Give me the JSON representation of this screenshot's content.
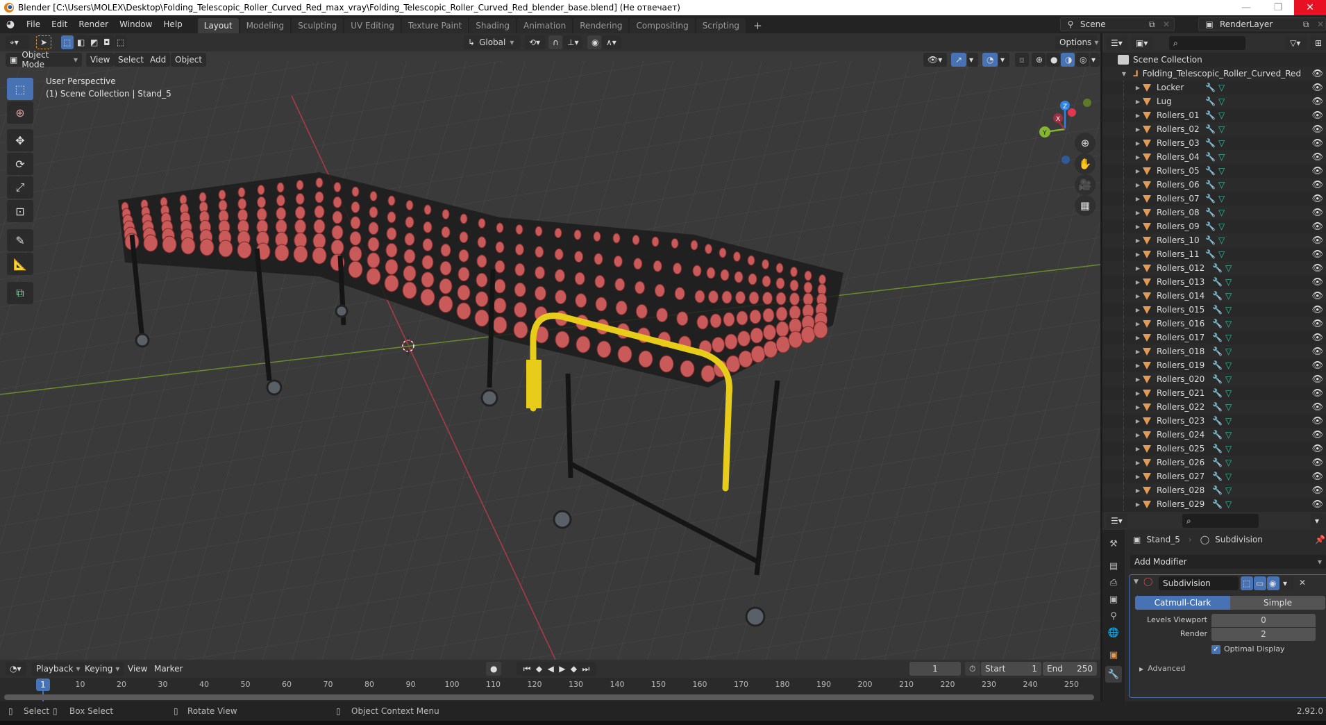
{
  "window": {
    "title": "Blender [C:\\Users\\MOLEX\\Desktop\\Folding_Telescopic_Roller_Curved_Red_max_vray\\Folding_Telescopic_Roller_Curved_Red_blender_base.blend] (Не отвечает)",
    "minimize": "—",
    "maximize": "❐",
    "close": "✕"
  },
  "menu": [
    "File",
    "Edit",
    "Render",
    "Window",
    "Help"
  ],
  "workspaces": [
    {
      "label": "Layout",
      "active": true
    },
    {
      "label": "Modeling"
    },
    {
      "label": "Sculpting"
    },
    {
      "label": "UV Editing"
    },
    {
      "label": "Texture Paint"
    },
    {
      "label": "Shading"
    },
    {
      "label": "Animation"
    },
    {
      "label": "Rendering"
    },
    {
      "label": "Compositing"
    },
    {
      "label": "Scripting"
    }
  ],
  "add_workspace": "+",
  "scene": {
    "label": "Scene",
    "view_layer": "RenderLayer"
  },
  "viewport": {
    "transform_orientation": "Global",
    "options_label": "Options",
    "mode": "Object Mode",
    "menus": [
      "View",
      "Select",
      "Add",
      "Object"
    ],
    "overlay_line1": "User Perspective",
    "overlay_line2": "(1) Scene Collection | Stand_5",
    "gizmo_axes": {
      "x": "X",
      "y": "Y",
      "z": "Z"
    },
    "colors": {
      "x_axis": "#e2374e",
      "y_axis": "#84b52e",
      "z_axis": "#2f84e3",
      "roller": "#c95a5a",
      "guard": "#f0d020"
    }
  },
  "outliner": {
    "root": "Scene Collection",
    "collection": "Folding_Telescopic_Roller_Curved_Red",
    "objects": [
      "Locker",
      "Lug",
      "Rollers_01",
      "Rollers_02",
      "Rollers_03",
      "Rollers_04",
      "Rollers_05",
      "Rollers_06",
      "Rollers_07",
      "Rollers_08",
      "Rollers_09",
      "Rollers_10",
      "Rollers_11",
      "Rollers_012",
      "Rollers_013",
      "Rollers_014",
      "Rollers_015",
      "Rollers_016",
      "Rollers_017",
      "Rollers_018",
      "Rollers_019",
      "Rollers_020",
      "Rollers_021",
      "Rollers_022",
      "Rollers_023",
      "Rollers_024",
      "Rollers_025",
      "Rollers_026",
      "Rollers_027",
      "Rollers_028",
      "Rollers_029"
    ]
  },
  "properties": {
    "object": "Stand_5",
    "modifier_breadcrumb": "Subdivision",
    "add_modifier": "Add Modifier",
    "modifier": {
      "name": "Subdivision",
      "mode_options": [
        "Catmull-Clark",
        "Simple"
      ],
      "active_mode": "Catmull-Clark",
      "levels_viewport_label": "Levels Viewport",
      "levels_viewport": "0",
      "render_label": "Render",
      "render": "2",
      "optimal_display_label": "Optimal Display",
      "optimal_display": true,
      "advanced_label": "Advanced"
    }
  },
  "timeline": {
    "menus": [
      "Playback",
      "Keying",
      "View",
      "Marker"
    ],
    "current_frame": "1",
    "start_label": "Start",
    "start": "1",
    "end_label": "End",
    "end": "250",
    "ticks": [
      "10",
      "20",
      "30",
      "40",
      "50",
      "60",
      "70",
      "80",
      "90",
      "100",
      "110",
      "120",
      "130",
      "140",
      "150",
      "160",
      "170",
      "180",
      "190",
      "200",
      "210",
      "220",
      "230",
      "240",
      "250"
    ]
  },
  "statusbar": {
    "select": "Select",
    "box_select": "Box Select",
    "rotate_view": "Rotate View",
    "context_menu": "Object Context Menu",
    "version": "2.92.0"
  }
}
